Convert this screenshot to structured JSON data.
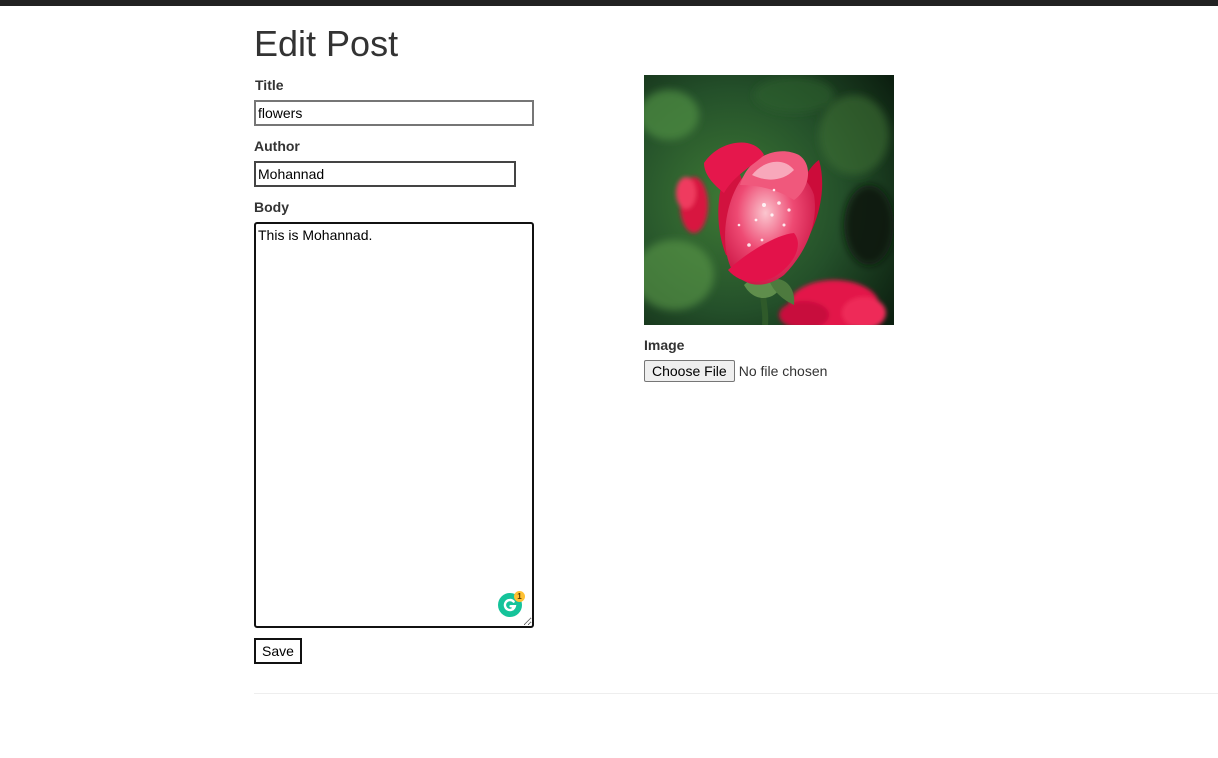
{
  "page": {
    "title": "Edit Post"
  },
  "form": {
    "title_label": "Title",
    "title_value": "flowers",
    "author_label": "Author",
    "author_value": "Mohannad",
    "body_label": "Body",
    "body_value": "This is Mohannad.",
    "save_label": "Save",
    "image_label": "Image",
    "choose_file_label": "Choose File",
    "file_status": "No file chosen"
  },
  "grammarly": {
    "icon": "grammarly-icon",
    "badge_count": "1",
    "color": "#15c39a",
    "badge_color": "#ffc132"
  },
  "image": {
    "subject": "rose-photo",
    "colors": {
      "petal": "#e0134a",
      "background": "#1f4a22"
    }
  },
  "colors": {
    "top_bar": "#222222",
    "text": "#333333"
  }
}
